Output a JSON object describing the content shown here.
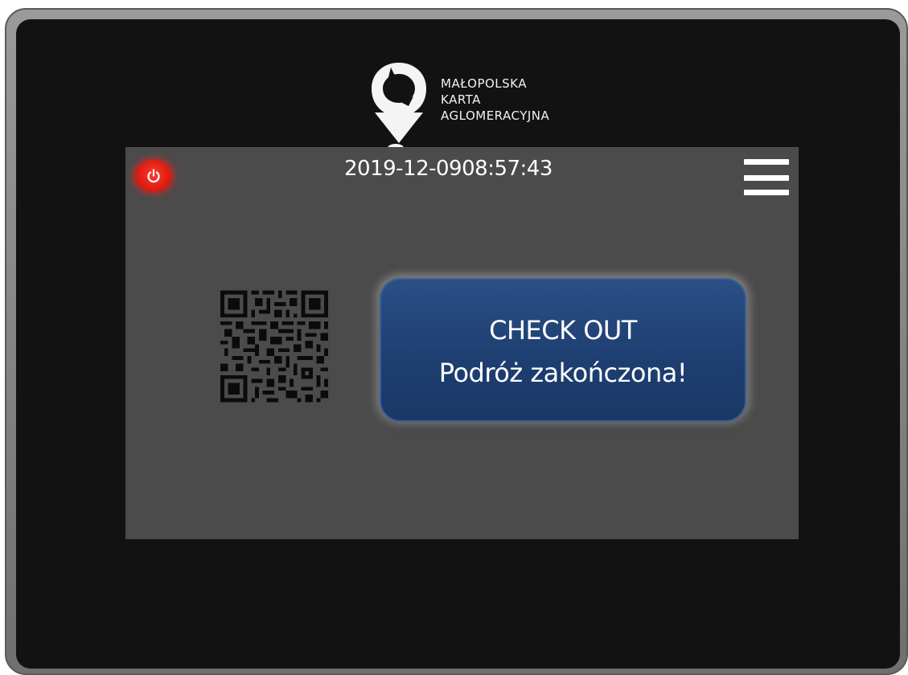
{
  "brand": {
    "logo_line1": "MAŁOPOLSKA",
    "logo_line2": "KARTA",
    "logo_line3": "AGLOMERACYJNA",
    "logo_icon": "location-pin-icon"
  },
  "header": {
    "date": "2019-12-09",
    "time": "08:57:43",
    "power_icon": "power-icon",
    "menu_icon": "hamburger-menu-icon"
  },
  "main": {
    "qr_icon": "qr-code-icon",
    "checkout_title": "CHECK OUT",
    "checkout_message": "Podróż zakończona!"
  },
  "colors": {
    "screen_bg": "#4b4b4b",
    "bezel": "#121212",
    "power_red": "#e01f14",
    "checkout_blue": "#1e3f72"
  }
}
